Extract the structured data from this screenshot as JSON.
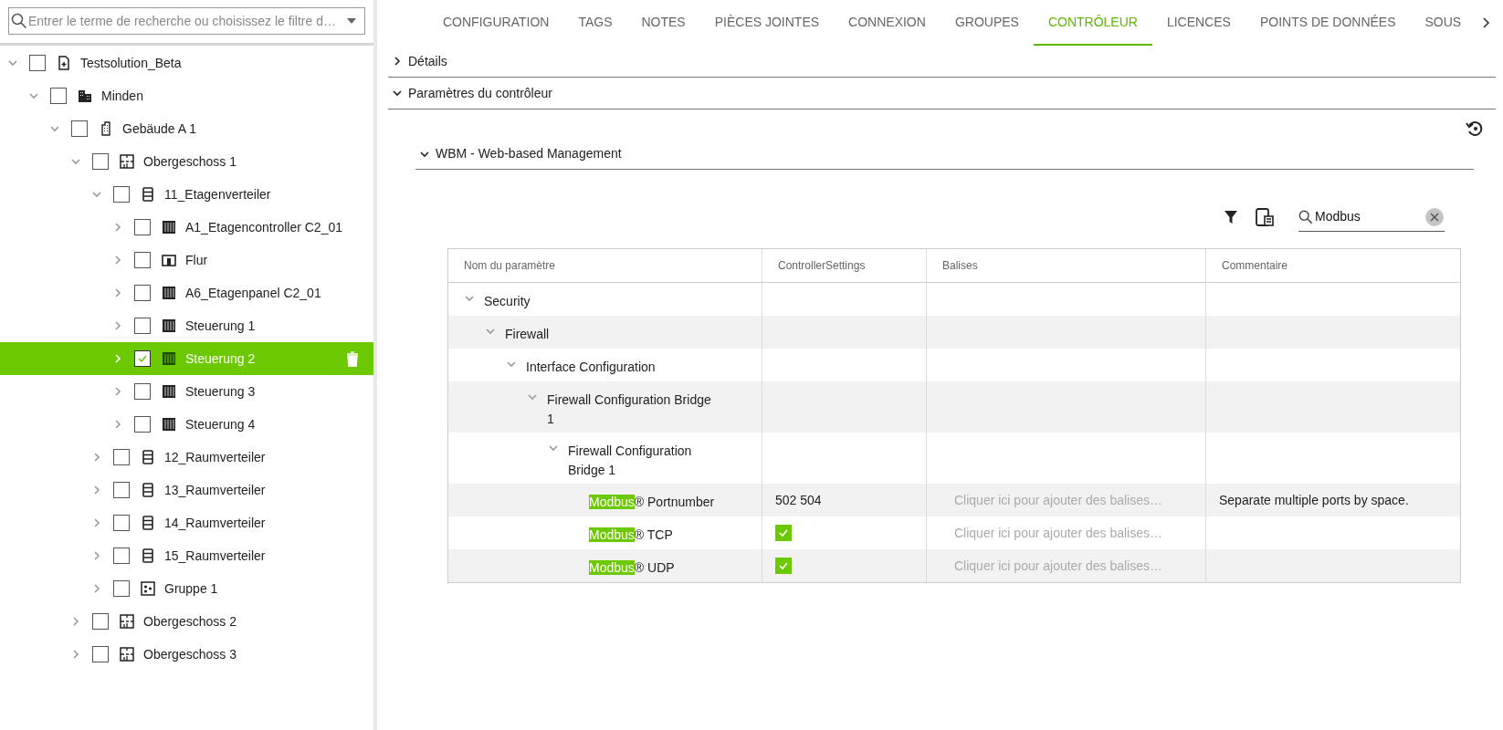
{
  "search": {
    "placeholder": "Entrer le terme de recherche ou choisissez le filtre d…"
  },
  "tree": [
    {
      "label": "Testsolution_Beta",
      "kind": "file",
      "expanded": true,
      "checked": false,
      "selected": false,
      "children": [
        {
          "label": "Minden",
          "kind": "city",
          "expanded": true,
          "checked": false,
          "selected": false,
          "children": [
            {
              "label": "Gebäude A 1",
              "kind": "building",
              "expanded": true,
              "checked": false,
              "selected": false,
              "children": [
                {
                  "label": "Obergeschoss 1",
                  "kind": "floor",
                  "expanded": true,
                  "checked": false,
                  "selected": false,
                  "children": [
                    {
                      "label": "11_Etagenverteiler",
                      "kind": "cabinet",
                      "expanded": true,
                      "checked": false,
                      "selected": false,
                      "children": [
                        {
                          "label": "A1_Etagencontroller C2_01",
                          "kind": "controller",
                          "expanded": false,
                          "checked": false,
                          "selected": false
                        },
                        {
                          "label": "Flur",
                          "kind": "room",
                          "expanded": false,
                          "checked": false,
                          "selected": false
                        },
                        {
                          "label": "A6_Etagenpanel C2_01",
                          "kind": "controller",
                          "expanded": false,
                          "checked": false,
                          "selected": false
                        },
                        {
                          "label": "Steuerung 1",
                          "kind": "controller",
                          "expanded": false,
                          "checked": false,
                          "selected": false
                        },
                        {
                          "label": "Steuerung 2",
                          "kind": "controller",
                          "expanded": false,
                          "checked": true,
                          "selected": true
                        },
                        {
                          "label": "Steuerung 3",
                          "kind": "controller",
                          "expanded": false,
                          "checked": false,
                          "selected": false
                        },
                        {
                          "label": "Steuerung 4",
                          "kind": "controller",
                          "expanded": false,
                          "checked": false,
                          "selected": false
                        }
                      ]
                    },
                    {
                      "label": "12_Raumverteiler",
                      "kind": "cabinet",
                      "expanded": false,
                      "checked": false,
                      "selected": false
                    },
                    {
                      "label": "13_Raumverteiler",
                      "kind": "cabinet",
                      "expanded": false,
                      "checked": false,
                      "selected": false
                    },
                    {
                      "label": "14_Raumverteiler",
                      "kind": "cabinet",
                      "expanded": false,
                      "checked": false,
                      "selected": false
                    },
                    {
                      "label": "15_Raumverteiler",
                      "kind": "cabinet",
                      "expanded": false,
                      "checked": false,
                      "selected": false
                    },
                    {
                      "label": "Gruppe 1",
                      "kind": "group",
                      "expanded": false,
                      "checked": false,
                      "selected": false
                    }
                  ]
                },
                {
                  "label": "Obergeschoss 2",
                  "kind": "floor",
                  "expanded": false,
                  "checked": false,
                  "selected": false
                },
                {
                  "label": "Obergeschoss 3",
                  "kind": "floor",
                  "expanded": false,
                  "checked": false,
                  "selected": false
                }
              ]
            }
          ]
        }
      ]
    }
  ],
  "tabs": [
    {
      "label": "CONFIGURATION",
      "selected": false
    },
    {
      "label": "TAGS",
      "selected": false
    },
    {
      "label": "NOTES",
      "selected": false
    },
    {
      "label": "PIÈCES JOINTES",
      "selected": false
    },
    {
      "label": "CONNEXION",
      "selected": false
    },
    {
      "label": "GROUPES",
      "selected": false
    },
    {
      "label": "CONTRÔLEUR",
      "selected": true
    },
    {
      "label": "LICENCES",
      "selected": false
    },
    {
      "label": "POINTS DE DONNÉES",
      "selected": false
    },
    {
      "label": "SOUS",
      "selected": false
    }
  ],
  "sections": [
    {
      "label": "Détails",
      "expanded": false
    },
    {
      "label": "Paramètres du contrôleur",
      "expanded": true
    }
  ],
  "subsection": {
    "label": "WBM - Web-based Management",
    "expanded": true
  },
  "table_search": {
    "value": "Modbus"
  },
  "table": {
    "columns": [
      "Nom du paramètre",
      "ControllerSettings",
      "Balises",
      "Commentaire"
    ],
    "rows": [
      {
        "name": "Security",
        "expanded": true,
        "children": [
          {
            "name": "Firewall",
            "expanded": true,
            "children": [
              {
                "name": "Interface Configuration",
                "expanded": true,
                "children": [
                  {
                    "name": "Firewall Configuration Bridge 1",
                    "expanded": true,
                    "children": [
                      {
                        "name": "Firewall Configuration Bridge 1",
                        "expanded": true,
                        "children": [
                          {
                            "match": "Modbus",
                            "name": "® Portnumber",
                            "kind": "text",
                            "value": "502 504",
                            "tags_placeholder": "Cliquer ici pour ajouter des balises…",
                            "comment": "Separate multiple ports by space."
                          },
                          {
                            "match": "Modbus",
                            "name": "® TCP",
                            "kind": "checkbox",
                            "checked": true,
                            "tags_placeholder": "Cliquer ici pour ajouter des balises…"
                          },
                          {
                            "match": "Modbus",
                            "name": "® UDP",
                            "kind": "checkbox",
                            "checked": true,
                            "tags_placeholder": "Cliquer ici pour ajouter des balises…"
                          }
                        ]
                      }
                    ]
                  }
                ]
              }
            ]
          }
        ]
      }
    ]
  }
}
